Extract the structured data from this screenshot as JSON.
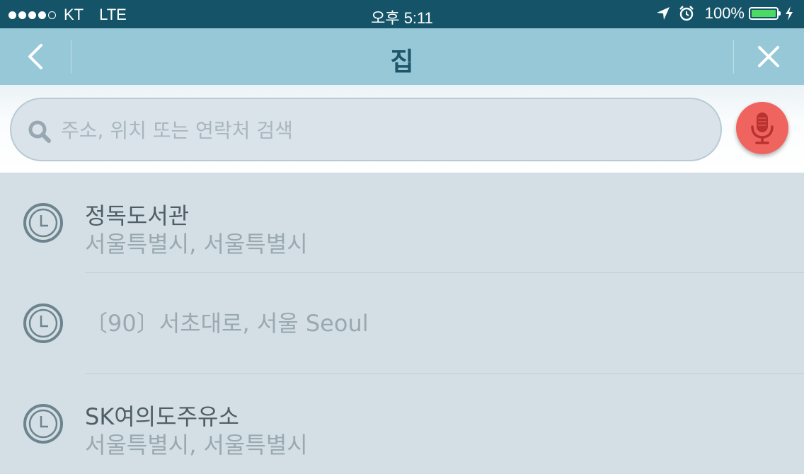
{
  "status_bar": {
    "carrier": "KT",
    "network": "LTE",
    "time": "오후 5:11",
    "battery_percent": "100%",
    "icons": [
      "location-arrow-icon",
      "alarm-icon",
      "battery-icon",
      "charging-bolt-icon"
    ],
    "signal_bars_filled": 4,
    "signal_bars_total": 5
  },
  "nav": {
    "title": "집",
    "back_icon": "chevron-left-icon",
    "close_icon": "close-icon"
  },
  "search": {
    "placeholder": "주소, 위치 또는 연락처 검색",
    "value": "",
    "icon": "search-icon",
    "mic_icon": "microphone-icon"
  },
  "recents": [
    {
      "title": "정독도서관",
      "subtitle": "서울특별시, 서울특별시"
    },
    {
      "title": "〔90〕서초대로, 서울 Seoul"
    },
    {
      "title": "SK여의도주유소",
      "subtitle": "서울특별시, 서울특별시"
    }
  ],
  "colors": {
    "status_bar_bg": "#155468",
    "nav_bg": "#97c8d7",
    "title_color": "#1e5569",
    "list_bg": "#d3dfe4",
    "mic_bg": "#f06460",
    "battery_fill": "#4cd964"
  }
}
